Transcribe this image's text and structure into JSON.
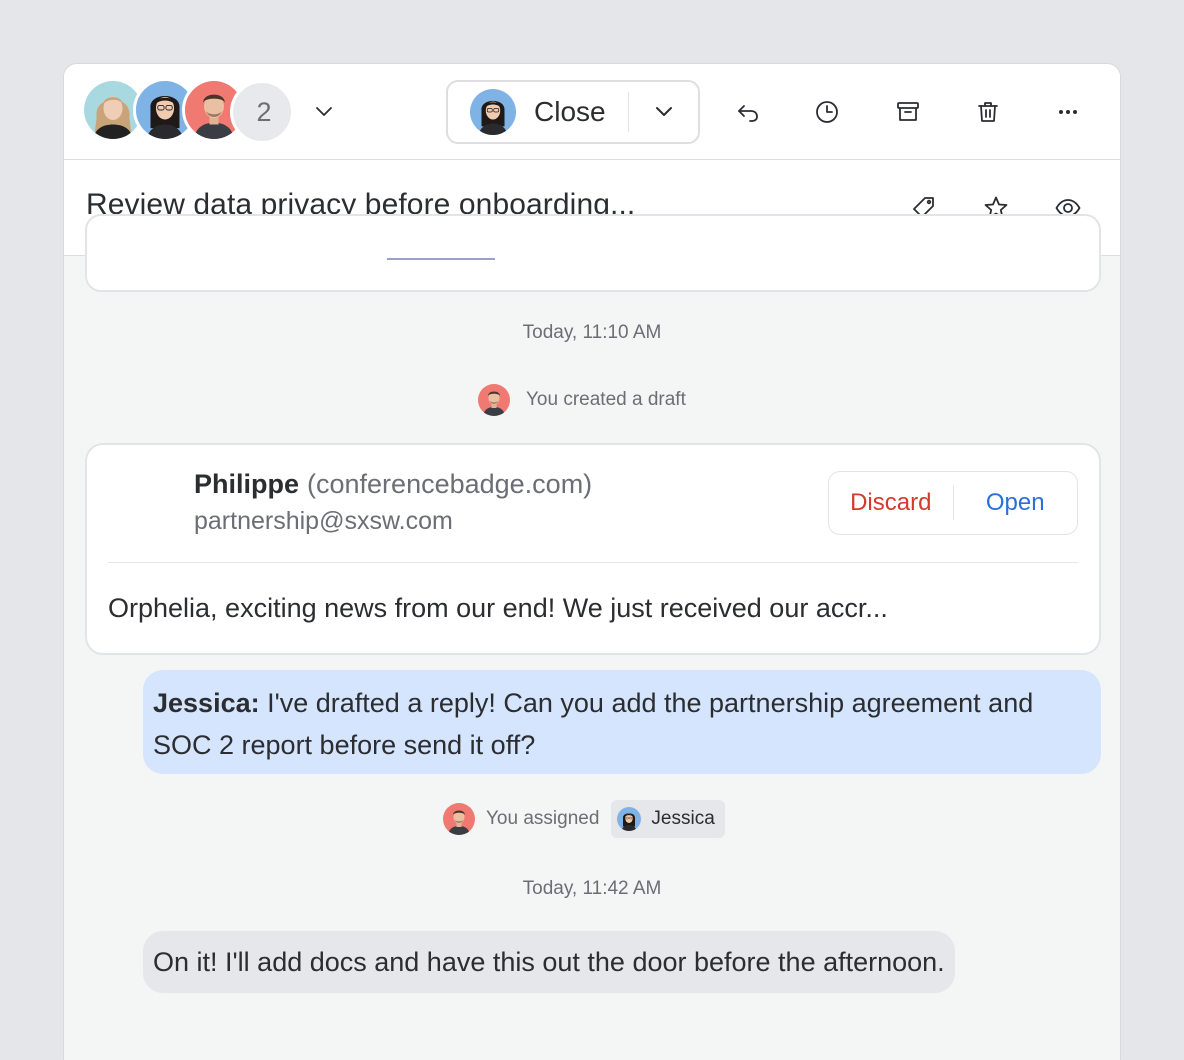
{
  "toolbar": {
    "participants": [
      {
        "name": "participant-1",
        "color": "#a8d8e0"
      },
      {
        "name": "participant-2",
        "color": "#7fb3e6"
      },
      {
        "name": "participant-3",
        "color": "#f07a72"
      }
    ],
    "extra_count": "2",
    "close_label": "Close",
    "icons": [
      "chevron-down-icon",
      "reply-icon",
      "clock-icon",
      "archive-icon",
      "trash-icon",
      "more-icon"
    ]
  },
  "subject": {
    "title": "Review data privacy before onboarding...",
    "icons": [
      "tag-icon",
      "star-icon",
      "eye-icon"
    ]
  },
  "timeline": {
    "timestamp_1": "Today, 11:10 AM",
    "draft_event": "You created a draft",
    "draft": {
      "sender_name": "Philippe",
      "sender_org": "(conferencebadge.com)",
      "sender_email": "partnership@sxsw.com",
      "discard_label": "Discard",
      "open_label": "Open",
      "preview": "Orphelia, exciting news from our end! We just received our accr..."
    },
    "comment_1": {
      "author": "Jessica:",
      "text": " I've drafted a reply! Can you add the partnership agreement and SOC 2 report before send it off?"
    },
    "assign_event": "You assigned",
    "assignee": "Jessica",
    "timestamp_2": "Today, 11:42 AM",
    "comment_2": {
      "text": "On it! I'll add docs and have this out the door before the afternoon."
    }
  },
  "colors": {
    "accent_blue": "#2a6fdb",
    "discard_red": "#d33a2c",
    "bubble_blue": "#d5e5fd",
    "bubble_grey": "#e6e7ea"
  }
}
